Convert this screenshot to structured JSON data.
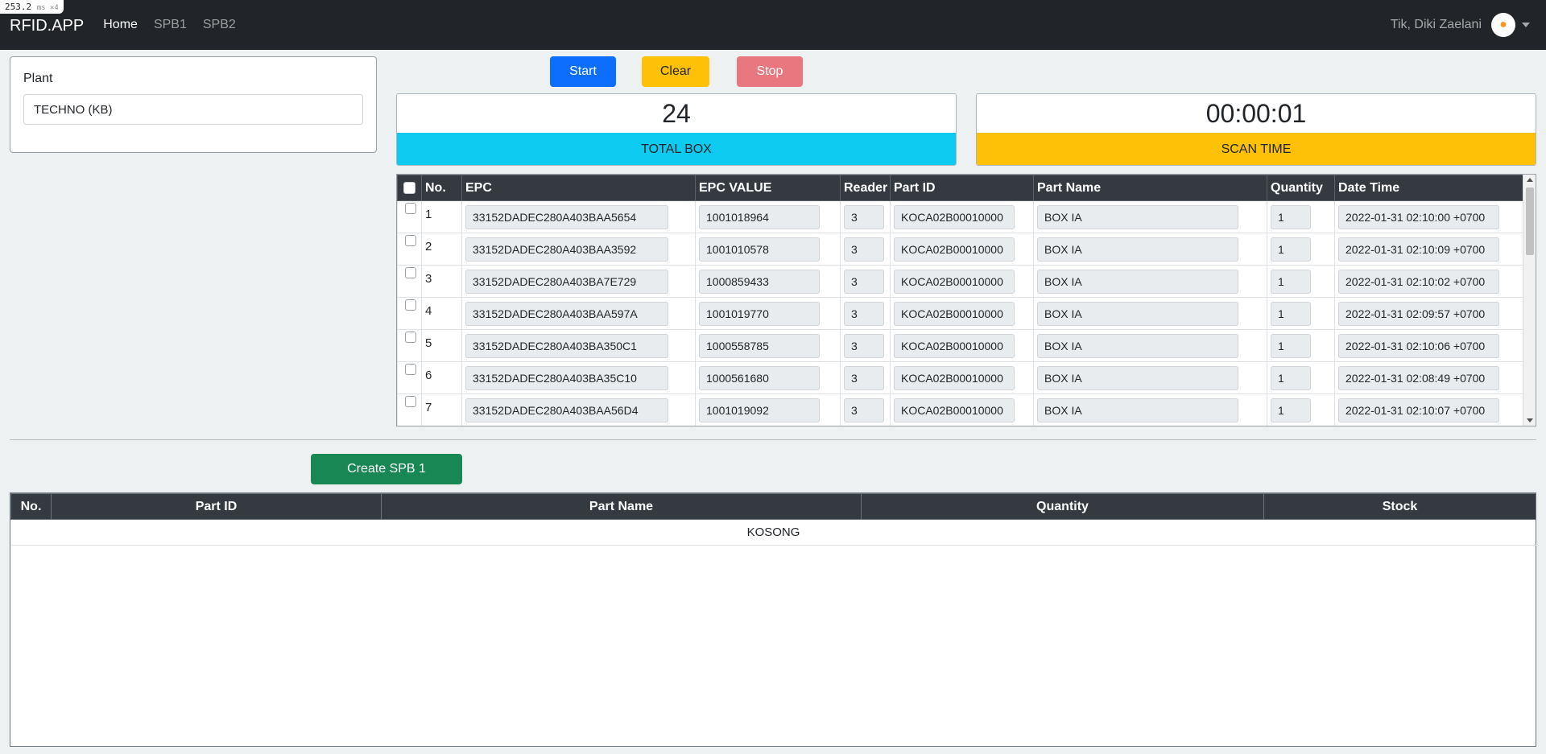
{
  "perf": {
    "value": "253.2",
    "unit": "ms ×4"
  },
  "navbar": {
    "brand": "RFID.APP",
    "links": [
      "Home",
      "SPB1",
      "SPB2"
    ],
    "user": "Tik, Diki Zaelani"
  },
  "plant": {
    "label": "Plant",
    "value": "TECHNO (KB)"
  },
  "controls": {
    "start": "Start",
    "clear": "Clear",
    "stop": "Stop"
  },
  "stats": {
    "total_box": {
      "value": "24",
      "label": "TOTAL BOX"
    },
    "scan_time": {
      "value": "00:00:01",
      "label": "SCAN TIME"
    }
  },
  "scan_table": {
    "headers": [
      "No.",
      "EPC",
      "EPC VALUE",
      "Reader",
      "Part ID",
      "Part Name",
      "Quantity",
      "Date Time"
    ],
    "rows": [
      {
        "no": "1",
        "epc": "33152DADEC280A403BAA5654",
        "epc_value": "1001018964",
        "reader": "3",
        "part_id": "KOCA02B00010000",
        "part_name": "BOX IA",
        "qty": "1",
        "datetime": "2022-01-31 02:10:00 +0700"
      },
      {
        "no": "2",
        "epc": "33152DADEC280A403BAA3592",
        "epc_value": "1001010578",
        "reader": "3",
        "part_id": "KOCA02B00010000",
        "part_name": "BOX IA",
        "qty": "1",
        "datetime": "2022-01-31 02:10:09 +0700"
      },
      {
        "no": "3",
        "epc": "33152DADEC280A403BA7E729",
        "epc_value": "1000859433",
        "reader": "3",
        "part_id": "KOCA02B00010000",
        "part_name": "BOX IA",
        "qty": "1",
        "datetime": "2022-01-31 02:10:02 +0700"
      },
      {
        "no": "4",
        "epc": "33152DADEC280A403BAA597A",
        "epc_value": "1001019770",
        "reader": "3",
        "part_id": "KOCA02B00010000",
        "part_name": "BOX IA",
        "qty": "1",
        "datetime": "2022-01-31 02:09:57 +0700"
      },
      {
        "no": "5",
        "epc": "33152DADEC280A403BA350C1",
        "epc_value": "1000558785",
        "reader": "3",
        "part_id": "KOCA02B00010000",
        "part_name": "BOX IA",
        "qty": "1",
        "datetime": "2022-01-31 02:10:06 +0700"
      },
      {
        "no": "6",
        "epc": "33152DADEC280A403BA35C10",
        "epc_value": "1000561680",
        "reader": "3",
        "part_id": "KOCA02B00010000",
        "part_name": "BOX IA",
        "qty": "1",
        "datetime": "2022-01-31 02:08:49 +0700"
      },
      {
        "no": "7",
        "epc": "33152DADEC280A403BAA56D4",
        "epc_value": "1001019092",
        "reader": "3",
        "part_id": "KOCA02B00010000",
        "part_name": "BOX IA",
        "qty": "1",
        "datetime": "2022-01-31 02:10:07 +0700"
      }
    ]
  },
  "create_button": "Create SPB 1",
  "spb_table": {
    "headers": [
      "No.",
      "Part ID",
      "Part Name",
      "Quantity",
      "Stock"
    ],
    "empty_text": "KOSONG"
  }
}
